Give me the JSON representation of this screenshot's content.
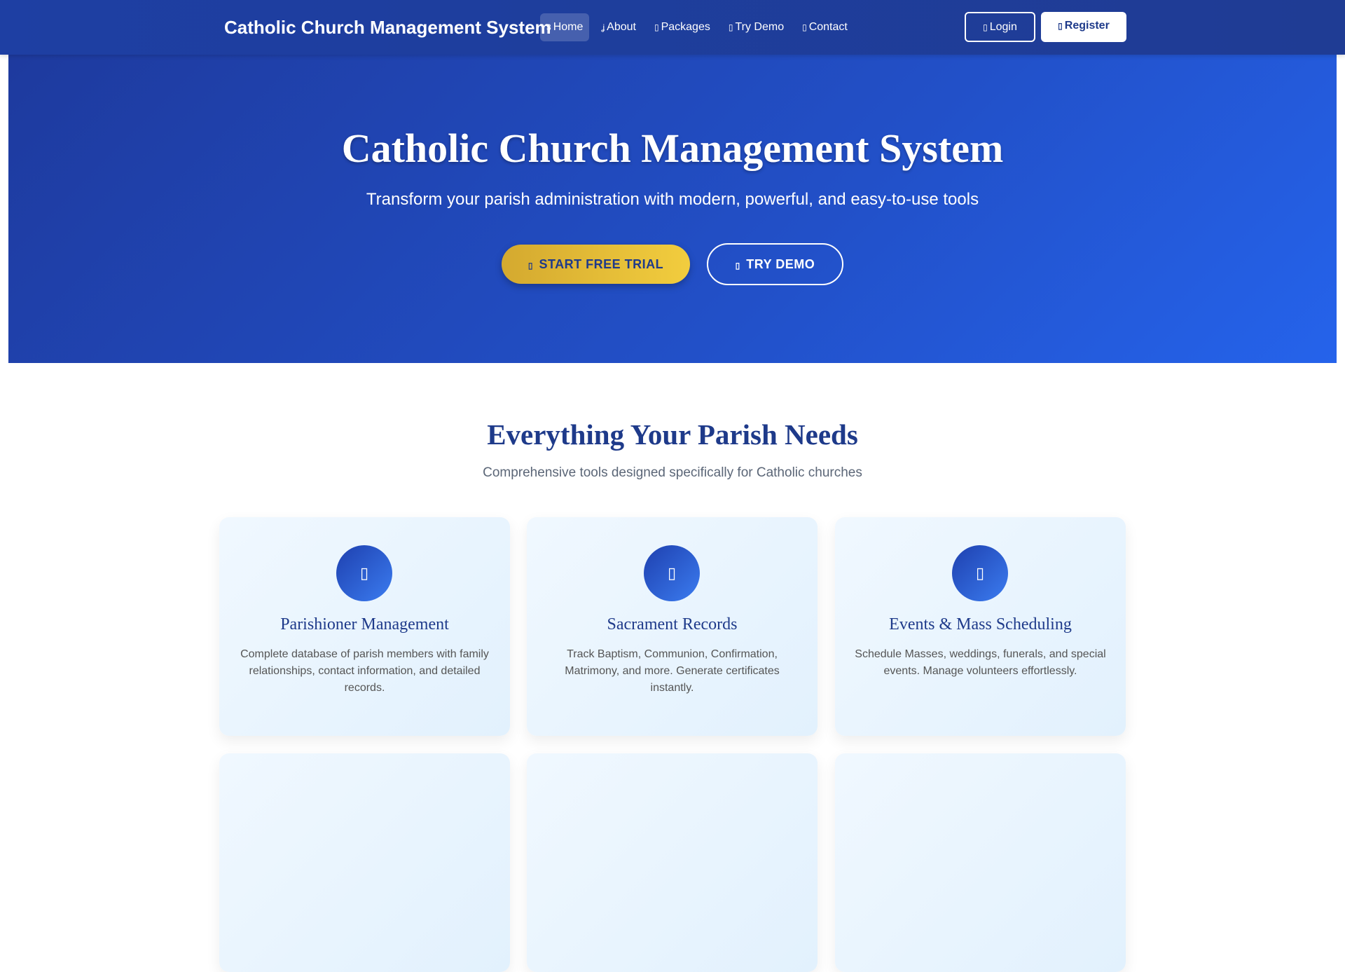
{
  "nav": {
    "brand": "Catholic Church Management System",
    "links": [
      {
        "icon": "3",
        "label": "Home"
      },
      {
        "icon": "ʝ",
        "label": "About"
      },
      {
        "icon": "▯",
        "label": "Packages"
      },
      {
        "icon": "▯",
        "label": "Try Demo"
      },
      {
        "icon": "▯",
        "label": "Contact"
      }
    ],
    "login": "Login",
    "register": "Register",
    "btn_icon": "▯"
  },
  "hero": {
    "title": "Catholic Church Management System",
    "subtitle": "Transform your parish administration with modern, powerful, and easy-to-use tools",
    "trial": "START FREE TRIAL",
    "demo": "TRY DEMO",
    "icon": "▯"
  },
  "features": {
    "title": "Everything Your Parish Needs",
    "subtitle": "Comprehensive tools designed specifically for Catholic churches",
    "cards": [
      {
        "icon": "▯",
        "title": "Parishioner Management",
        "desc": "Complete database of parish members with family relationships, contact information, and detailed records."
      },
      {
        "icon": "▯",
        "title": "Sacrament Records",
        "desc": "Track Baptism, Communion, Confirmation, Matrimony, and more. Generate certificates instantly."
      },
      {
        "icon": "▯",
        "title": "Events & Mass Scheduling",
        "desc": "Schedule Masses, weddings, funerals, and special events. Manage volunteers effortlessly."
      }
    ]
  }
}
